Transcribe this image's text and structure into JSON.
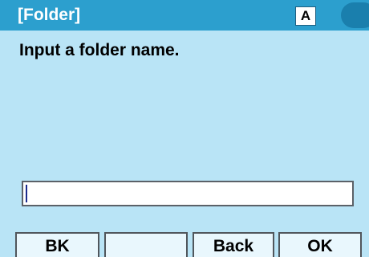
{
  "header": {
    "title": "[Folder]",
    "input_mode": "A"
  },
  "main": {
    "prompt": "Input a folder name.",
    "input": {
      "value": ""
    }
  },
  "softkeys": [
    {
      "label": "BK"
    },
    {
      "label": ""
    },
    {
      "label": "Back"
    },
    {
      "label": "OK"
    }
  ],
  "colors": {
    "title_bar": "#2c9fce",
    "background": "#b9e4f6",
    "softkey_bg": "#e9f7fd"
  }
}
